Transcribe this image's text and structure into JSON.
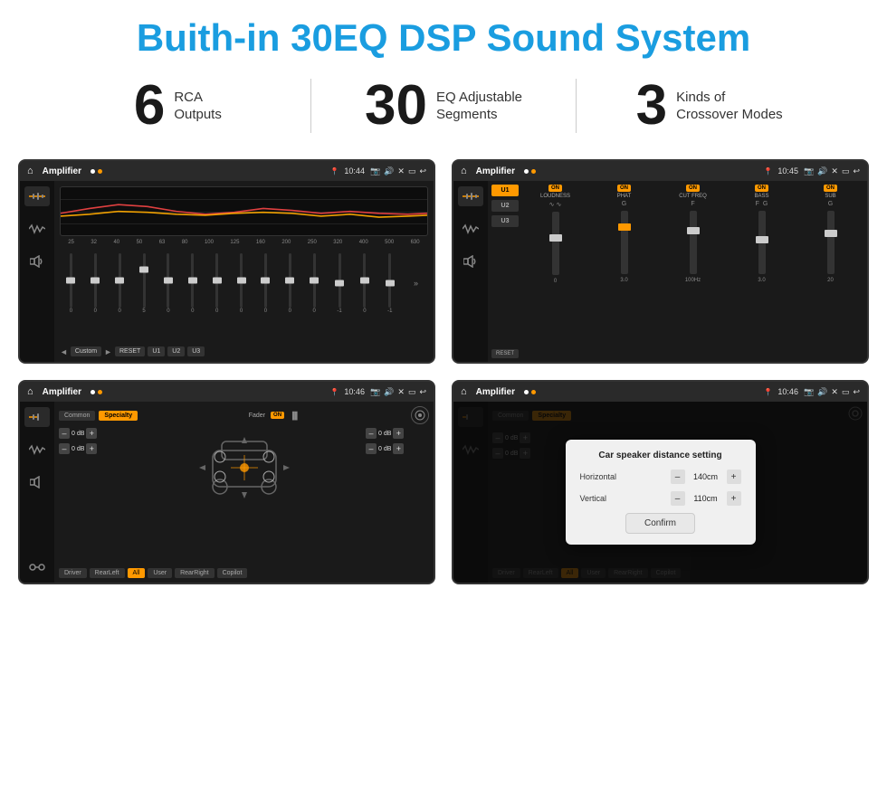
{
  "header": {
    "title": "Buith-in 30EQ DSP Sound System"
  },
  "stats": [
    {
      "number": "6",
      "line1": "RCA",
      "line2": "Outputs"
    },
    {
      "number": "30",
      "line1": "EQ Adjustable",
      "line2": "Segments"
    },
    {
      "number": "3",
      "line1": "Kinds of",
      "line2": "Crossover Modes"
    }
  ],
  "screens": {
    "eq": {
      "topbar": {
        "title": "Amplifier",
        "time": "10:44"
      },
      "freqs": [
        "25",
        "32",
        "40",
        "50",
        "63",
        "80",
        "100",
        "125",
        "160",
        "200",
        "250",
        "320",
        "400",
        "500",
        "630"
      ],
      "values": [
        "0",
        "0",
        "0",
        "5",
        "0",
        "0",
        "0",
        "0",
        "0",
        "0",
        "0",
        "-1",
        "0",
        "-1"
      ],
      "buttons": [
        "Custom",
        "RESET",
        "U1",
        "U2",
        "U3"
      ]
    },
    "amp": {
      "topbar": {
        "title": "Amplifier",
        "time": "10:45"
      },
      "presets": [
        "U1",
        "U2",
        "U3"
      ],
      "controls": [
        "LOUDNESS",
        "PHAT",
        "CUT FREQ",
        "BASS",
        "SUB"
      ],
      "reset": "RESET"
    },
    "fader": {
      "topbar": {
        "title": "Amplifier",
        "time": "10:46"
      },
      "tabs": [
        "Common",
        "Specialty"
      ],
      "fader_label": "Fader",
      "on_label": "ON",
      "db_values": [
        "0 dB",
        "0 dB",
        "0 dB",
        "0 dB"
      ],
      "buttons": [
        "Driver",
        "RearLeft",
        "All",
        "User",
        "RearRight",
        "Copilot"
      ]
    },
    "dialog": {
      "topbar": {
        "title": "Amplifier",
        "time": "10:46"
      },
      "tabs": [
        "Common",
        "Specialty"
      ],
      "dialog_title": "Car speaker distance setting",
      "horizontal_label": "Horizontal",
      "horizontal_value": "140cm",
      "vertical_label": "Vertical",
      "vertical_value": "110cm",
      "confirm_label": "Confirm",
      "db_values": [
        "0 dB",
        "0 dB"
      ],
      "buttons": [
        "Driver",
        "RearLeft",
        "All",
        "User",
        "RearRight",
        "Copilot"
      ]
    }
  },
  "icons": {
    "home": "⌂",
    "back": "↩",
    "location": "📍",
    "camera": "📷",
    "volume": "🔊",
    "settings": "⚙",
    "eq_icon": "≡",
    "wave_icon": "∿",
    "speaker_icon": "▣"
  }
}
